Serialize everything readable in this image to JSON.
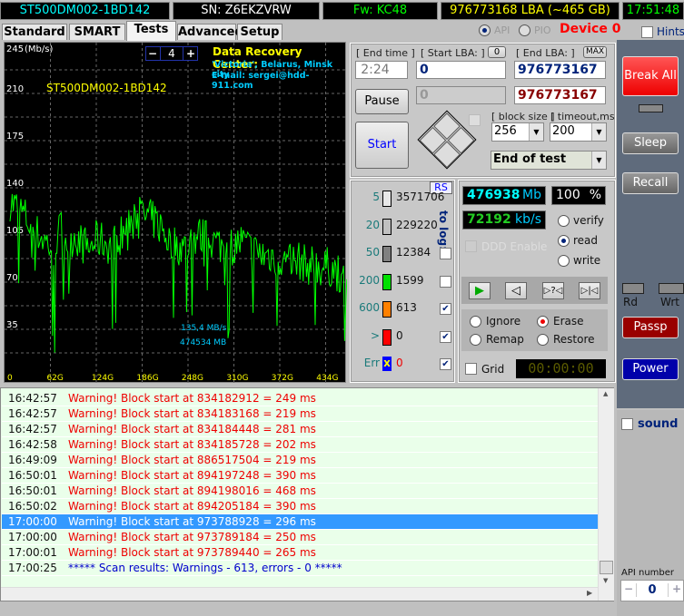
{
  "header": {
    "model": "ST500DM002-1BD142",
    "serial": "SN: Z6EKZVRW",
    "firmware": "Fw: KC48",
    "capacity": "976773168 LBA (~465 GB)",
    "clock": "17:51:48"
  },
  "tabs": [
    {
      "label": "Standard"
    },
    {
      "label": "SMART"
    },
    {
      "label": "Tests",
      "active": true
    },
    {
      "label": "Advanced"
    },
    {
      "label": "Setup"
    }
  ],
  "mode": {
    "api": "API",
    "pio": "PIO",
    "selected": "API",
    "device": "Device 0",
    "hints": "Hints"
  },
  "graph": {
    "title_center": "Data Recovery Center:",
    "line2": "'Victoria', Belarus, Minsk city",
    "line3": "E-mail: sergei@hdd-911.com",
    "drive_label": "ST500DM002-1BD142",
    "zoom_value": "4",
    "zoom_minus": "−",
    "zoom_plus": "+",
    "speed_readout": "135,4 MB/s",
    "position_readout": "474534 MB"
  },
  "chart_data": {
    "type": "line",
    "ylabel": "(Mb/s)",
    "y_ticks": [
      "245",
      "210",
      "175",
      "140",
      "105",
      "70",
      "35",
      "0"
    ],
    "ylim": [
      0,
      245
    ],
    "x_ticks": [
      "0",
      "62G",
      "124G",
      "186G",
      "248G",
      "310G",
      "372G",
      "434G"
    ],
    "xlim": [
      0,
      465
    ],
    "grid": true,
    "color": "#00ff00",
    "series": [
      {
        "x": [
          0,
          10,
          20,
          30,
          40,
          50,
          60,
          70,
          80,
          90,
          100,
          110,
          120,
          130,
          140,
          150,
          160,
          170,
          180,
          190,
          200,
          210,
          220,
          230,
          240,
          250,
          260,
          270,
          280,
          290,
          300,
          310,
          320,
          330,
          340,
          350,
          360,
          370,
          380,
          390,
          400,
          410,
          420,
          430,
          440,
          450,
          460
        ],
        "values": [
          130,
          125,
          120,
          110,
          105,
          100,
          95,
          110,
          100,
          105,
          98,
          95,
          102,
          100,
          96,
          104,
          108,
          124,
          120,
          118,
          115,
          110,
          100,
          98,
          95,
          100,
          105,
          102,
          100,
          98,
          95,
          98,
          100,
          95,
          92,
          90,
          90,
          88,
          85,
          84,
          86,
          82,
          84,
          80,
          82,
          78,
          76
        ]
      }
    ]
  },
  "controls": {
    "end_time_label": "[ End time ]",
    "end_time": "2:24",
    "start_lba_label": "[ Start LBA: ]",
    "start_lba_btn": "0",
    "end_lba_label": "[ End LBA: ]",
    "end_lba_btn": "MAX",
    "start_lba": "0",
    "end_lba": "976773167",
    "cur_lba": "0",
    "end_lba2": "976773167",
    "pause": "Pause",
    "start": "Start",
    "block_size_label": "[ block size ]",
    "block_size": "256",
    "timeout_label": "[ timeout,ms ]",
    "timeout": "200",
    "end_action": "End of test"
  },
  "counters": {
    "rs": "RS",
    "to_log": "to log:",
    "items": [
      {
        "threshold": "5",
        "count": "3571706",
        "color": "#e8e8e8"
      },
      {
        "threshold": "20",
        "count": "229220",
        "color": "#c0c0c0"
      },
      {
        "threshold": "50",
        "count": "12384",
        "color": "#808080",
        "log": false
      },
      {
        "threshold": "200",
        "count": "1599",
        "color": "#00e000",
        "log": false
      },
      {
        "threshold": "600",
        "count": "613",
        "color": "#ff8000",
        "log": true
      },
      {
        "threshold": ">",
        "count": "0",
        "color": "#ff0000",
        "log": true
      },
      {
        "threshold": "Err",
        "count": "0",
        "color": "#0000ff",
        "log": true
      }
    ]
  },
  "status": {
    "mb": "476938",
    "mb_unit": "Mb",
    "percent": "100",
    "percent_unit": "%",
    "speed": "72192",
    "speed_unit": "kb/s",
    "ddd": "DDD Enable",
    "verify": "verify",
    "read": "read",
    "write": "write",
    "selected": "read",
    "ignore": "Ignore",
    "erase": "Erase",
    "remap": "Remap",
    "restore": "Restore",
    "repair_selected": "Erase",
    "grid": "Grid",
    "timer": "00:00:00"
  },
  "side": {
    "break_all": "Break All",
    "sleep": "Sleep",
    "recall": "Recall",
    "rd": "Rd",
    "wrt": "Wrt",
    "passp": "Passp",
    "power": "Power",
    "sound": "sound",
    "api_number_label": "API number",
    "api_number": "0"
  },
  "log": [
    {
      "time": "16:42:57",
      "msg": "Warning! Block start at 834182912 = 249 ms",
      "type": "warn"
    },
    {
      "time": "16:42:57",
      "msg": "Warning! Block start at 834183168 = 219 ms",
      "type": "warn"
    },
    {
      "time": "16:42:57",
      "msg": "Warning! Block start at 834184448 = 281 ms",
      "type": "warn"
    },
    {
      "time": "16:42:58",
      "msg": "Warning! Block start at 834185728 = 202 ms",
      "type": "warn"
    },
    {
      "time": "16:49:09",
      "msg": "Warning! Block start at 886517504 = 219 ms",
      "type": "warn"
    },
    {
      "time": "16:50:01",
      "msg": "Warning! Block start at 894197248 = 390 ms",
      "type": "warn"
    },
    {
      "time": "16:50:01",
      "msg": "Warning! Block start at 894198016 = 468 ms",
      "type": "warn"
    },
    {
      "time": "16:50:02",
      "msg": "Warning! Block start at 894205184 = 390 ms",
      "type": "warn"
    },
    {
      "time": "17:00:00",
      "msg": "Warning! Block start at 973788928 = 296 ms",
      "type": "selected"
    },
    {
      "time": "17:00:00",
      "msg": "Warning! Block start at 973789184 = 250 ms",
      "type": "warn"
    },
    {
      "time": "17:00:01",
      "msg": "Warning! Block start at 973789440 = 265 ms",
      "type": "warn"
    },
    {
      "time": "17:00:25",
      "msg": "***** Scan results: Warnings - 613, errors - 0 *****",
      "type": "info"
    }
  ]
}
